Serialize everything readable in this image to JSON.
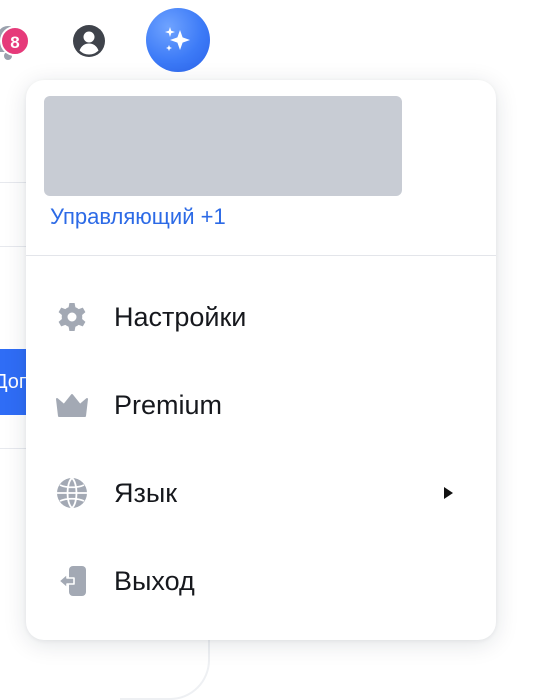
{
  "header": {
    "notification_count": "8",
    "notifications_icon": "bell-icon",
    "profile_icon": "user-circle-icon",
    "assistant_icon": "sparkles-icon"
  },
  "background": {
    "button_fragment": "Доп"
  },
  "dropdown": {
    "account": {
      "role_label": "Управляющий +1"
    },
    "items": [
      {
        "label": "Настройки",
        "icon": "gear-icon"
      },
      {
        "label": "Premium",
        "icon": "crown-icon"
      },
      {
        "label": "Язык",
        "icon": "globe-icon",
        "has_submenu": true
      },
      {
        "label": "Выход",
        "icon": "logout-icon"
      }
    ]
  },
  "colors": {
    "accent_blue": "#2c6ae6",
    "badge_pink": "#e63a7a",
    "icon_gray": "#a3a9b4",
    "placeholder_gray": "#c8ccd4"
  }
}
